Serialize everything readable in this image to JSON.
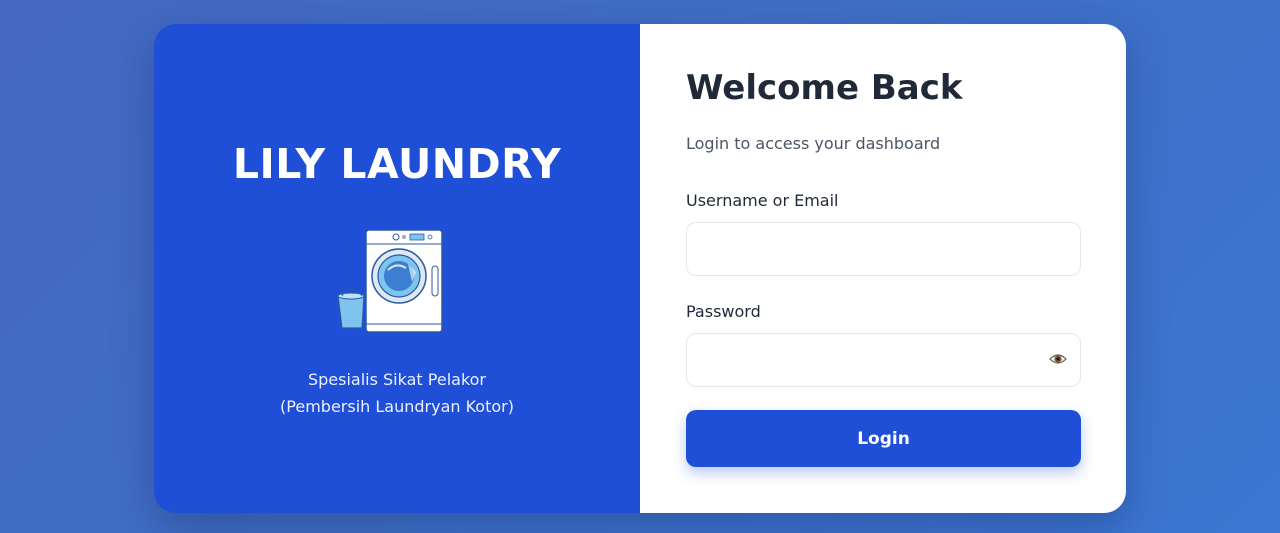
{
  "brand": {
    "name": "LILY LAUNDRY",
    "tagline_line1": "Spesialis Sikat Pelakor",
    "tagline_line2": "(Pembersih Laundryan Kotor)",
    "illustration": "washing-machine-with-bucket"
  },
  "login": {
    "title": "Welcome Back",
    "subtitle": "Login to access your dashboard",
    "username_label": "Username or Email",
    "username_value": "",
    "password_label": "Password",
    "password_value": "",
    "toggle_icon": "eye-icon",
    "submit_label": "Login"
  },
  "colors": {
    "primary": "#1f4fd6",
    "background": "#3f6fc6",
    "heading": "#1f2937",
    "muted": "#4b5563"
  }
}
